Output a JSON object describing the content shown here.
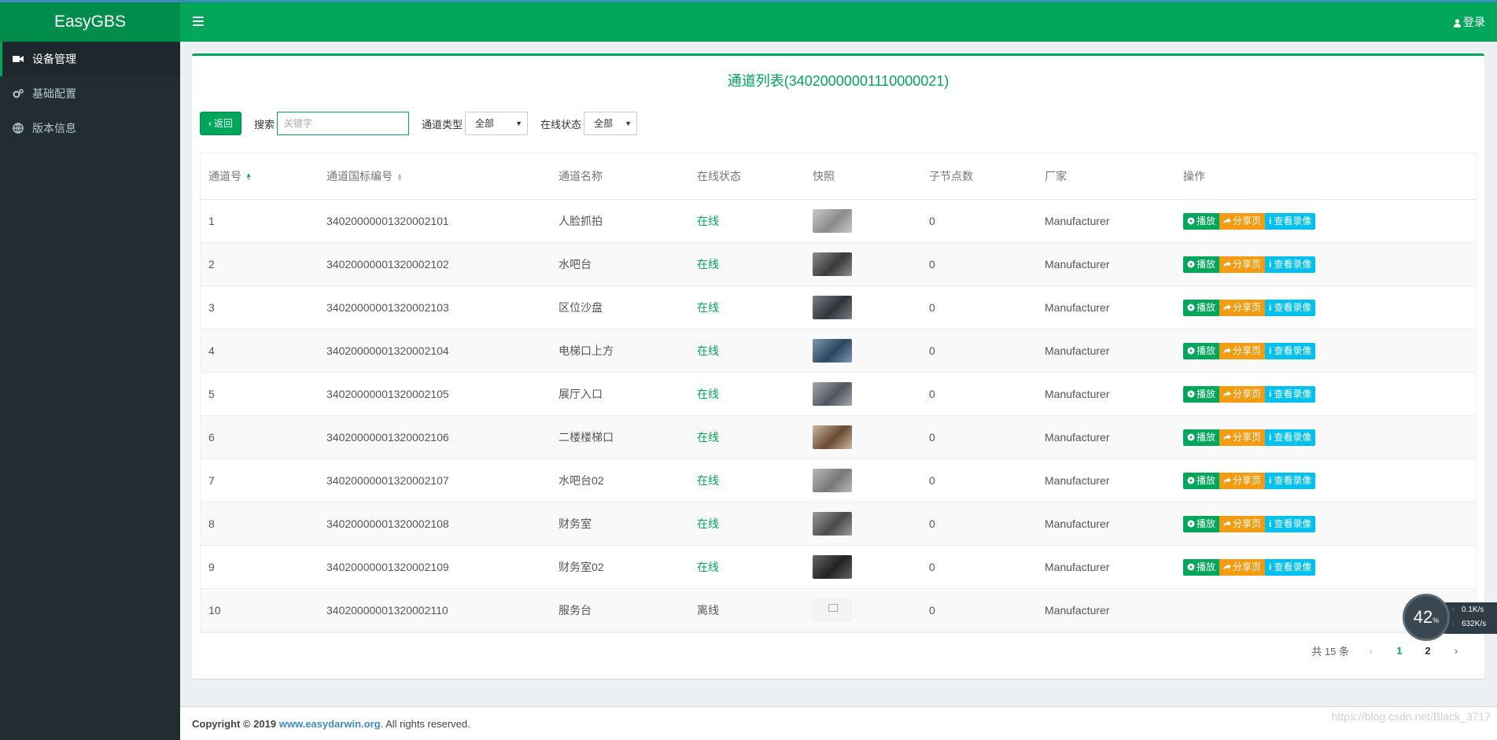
{
  "header": {
    "brand": "EasyGBS",
    "login_label": "登录"
  },
  "sidebar": {
    "items": [
      {
        "label": "设备管理",
        "icon": "video-camera-icon",
        "active": true
      },
      {
        "label": "基础配置",
        "icon": "cogs-icon",
        "active": false
      },
      {
        "label": "版本信息",
        "icon": "globe-icon",
        "active": false
      }
    ]
  },
  "main": {
    "title": "通道列表(34020000001110000021)",
    "toolbar": {
      "back_label": "返回",
      "search_label": "搜索",
      "search_placeholder": "关键字",
      "channel_type_label": "通道类型",
      "channel_type_value": "全部",
      "online_status_label": "在线状态",
      "online_status_value": "全部"
    },
    "table": {
      "columns": [
        "通道号",
        "通道国标编号",
        "通道名称",
        "在线状态",
        "快照",
        "子节点数",
        "厂家",
        "操作"
      ],
      "actions": {
        "play": "播放",
        "share": "分享页",
        "record": "查看录像"
      },
      "rows": [
        {
          "no": "1",
          "code": "34020000001320002101",
          "name": "人脸抓拍",
          "status": "在线",
          "children": "0",
          "vendor": "Manufacturer"
        },
        {
          "no": "2",
          "code": "34020000001320002102",
          "name": "水吧台",
          "status": "在线",
          "children": "0",
          "vendor": "Manufacturer"
        },
        {
          "no": "3",
          "code": "34020000001320002103",
          "name": "区位沙盘",
          "status": "在线",
          "children": "0",
          "vendor": "Manufacturer"
        },
        {
          "no": "4",
          "code": "34020000001320002104",
          "name": "电梯口上方",
          "status": "在线",
          "children": "0",
          "vendor": "Manufacturer"
        },
        {
          "no": "5",
          "code": "34020000001320002105",
          "name": "展厅入口",
          "status": "在线",
          "children": "0",
          "vendor": "Manufacturer"
        },
        {
          "no": "6",
          "code": "34020000001320002106",
          "name": "二楼楼梯口",
          "status": "在线",
          "children": "0",
          "vendor": "Manufacturer"
        },
        {
          "no": "7",
          "code": "34020000001320002107",
          "name": "水吧台02",
          "status": "在线",
          "children": "0",
          "vendor": "Manufacturer"
        },
        {
          "no": "8",
          "code": "34020000001320002108",
          "name": "财务室",
          "status": "在线",
          "children": "0",
          "vendor": "Manufacturer"
        },
        {
          "no": "9",
          "code": "34020000001320002109",
          "name": "财务室02",
          "status": "在线",
          "children": "0",
          "vendor": "Manufacturer"
        },
        {
          "no": "10",
          "code": "34020000001320002110",
          "name": "服务台",
          "status": "离线",
          "children": "0",
          "vendor": "Manufacturer"
        }
      ]
    },
    "pagination": {
      "total": "共 15 条",
      "pages": [
        "1",
        "2"
      ],
      "current": "1"
    }
  },
  "footer": {
    "copyright_prefix": "Copyright © 2019",
    "link_text": "www.easydarwin.org",
    "suffix": ". All rights reserved.",
    "watermark": "https://blog.csdn.net/Black_3717"
  },
  "speed_widget": {
    "percent": "42",
    "percent_unit": "%",
    "upload": "0.1",
    "upload_unit": "K/s",
    "download": "632",
    "download_unit": "K/s"
  },
  "colors": {
    "primary": "#00a65a",
    "warning": "#f39c12",
    "info": "#00c0ef",
    "sidebar": "#222d32"
  }
}
